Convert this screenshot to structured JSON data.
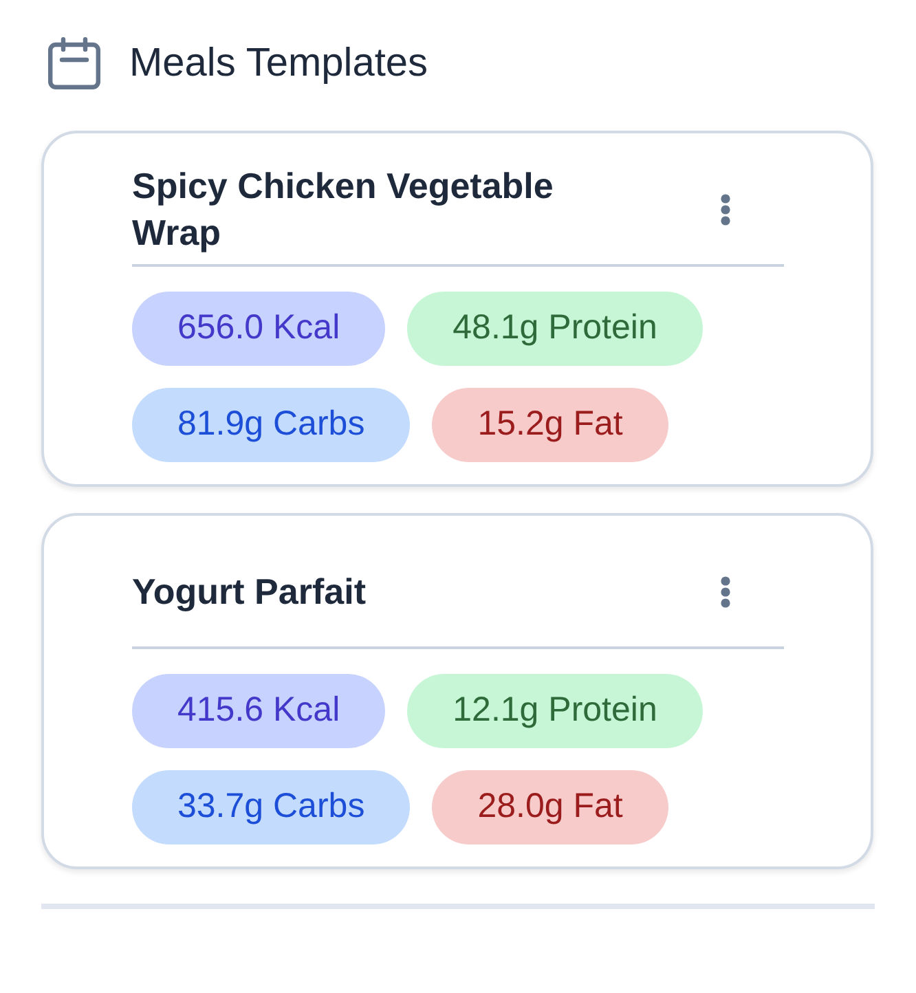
{
  "header": {
    "title": "Meals Templates"
  },
  "templates": [
    {
      "name": "Spicy Chicken Vegetable Wrap",
      "nutrients": [
        {
          "kind": "kcal",
          "label": "656.0 Kcal"
        },
        {
          "kind": "protein",
          "label": "48.1g Protein"
        },
        {
          "kind": "carbs",
          "label": "81.9g Carbs"
        },
        {
          "kind": "fat",
          "label": "15.2g Fat"
        }
      ]
    },
    {
      "name": "Yogurt Parfait",
      "nutrients": [
        {
          "kind": "kcal",
          "label": "415.6 Kcal"
        },
        {
          "kind": "protein",
          "label": "12.1g Protein"
        },
        {
          "kind": "carbs",
          "label": "33.7g Carbs"
        },
        {
          "kind": "fat",
          "label": "28.0g Fat"
        }
      ]
    }
  ]
}
